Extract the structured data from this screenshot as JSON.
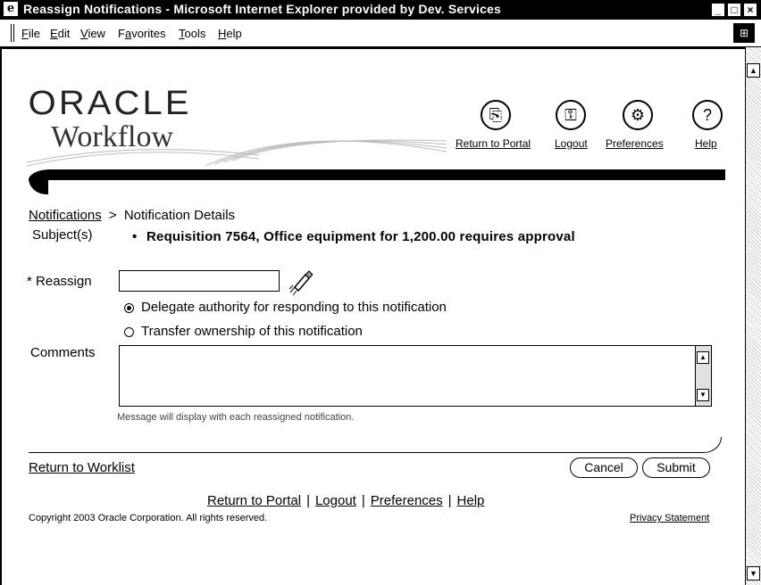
{
  "window": {
    "title": "Reassign Notifications - Microsoft Internet Explorer provided by Dev. Services",
    "controls": [
      "_",
      "□",
      "×"
    ]
  },
  "menu": {
    "items": [
      {
        "key": "F",
        "rest": "ile"
      },
      {
        "key": "E",
        "rest": "dit"
      },
      {
        "key": "V",
        "rest": "iew"
      },
      {
        "key": "a",
        "pre": "F",
        "rest": "vorites"
      },
      {
        "key": "T",
        "rest": "ools"
      },
      {
        "key": "H",
        "rest": "elp"
      }
    ]
  },
  "branding": {
    "logo_top": "ORACLE",
    "logo_bottom": "Workflow"
  },
  "global_buttons": [
    {
      "label": "Return to Portal",
      "icon": "portal-icon"
    },
    {
      "label": "Logout",
      "icon": "logout-icon"
    },
    {
      "label": "Preferences",
      "icon": "preferences-icon"
    },
    {
      "label": "Help",
      "icon": "help-icon"
    }
  ],
  "breadcrumb": {
    "link": "Notifications",
    "sep": ">",
    "current": "Notification Details"
  },
  "subject": {
    "label": "Subject(s)",
    "value": "Requisition 7564, Office equipment for 1,200.00 requires approval"
  },
  "form": {
    "reassign_label": "Reassign",
    "required_mark": "*",
    "reassign_value": "",
    "radio_delegate": "Delegate authority for responding to this notification",
    "radio_transfer": "Transfer ownership of this notification",
    "comments_label": "Comments",
    "comments_value": "",
    "hint": "Message will display with each reassigned notification."
  },
  "actions": {
    "return_link": "Return to Worklist",
    "cancel": "Cancel",
    "submit": "Submit"
  },
  "footer": {
    "links": [
      "Return to Portal",
      "Logout",
      "Preferences",
      "Help"
    ],
    "separator": "|",
    "copyright": "Copyright 2003 Oracle Corporation. All rights reserved.",
    "privacy": "Privacy Statement"
  }
}
